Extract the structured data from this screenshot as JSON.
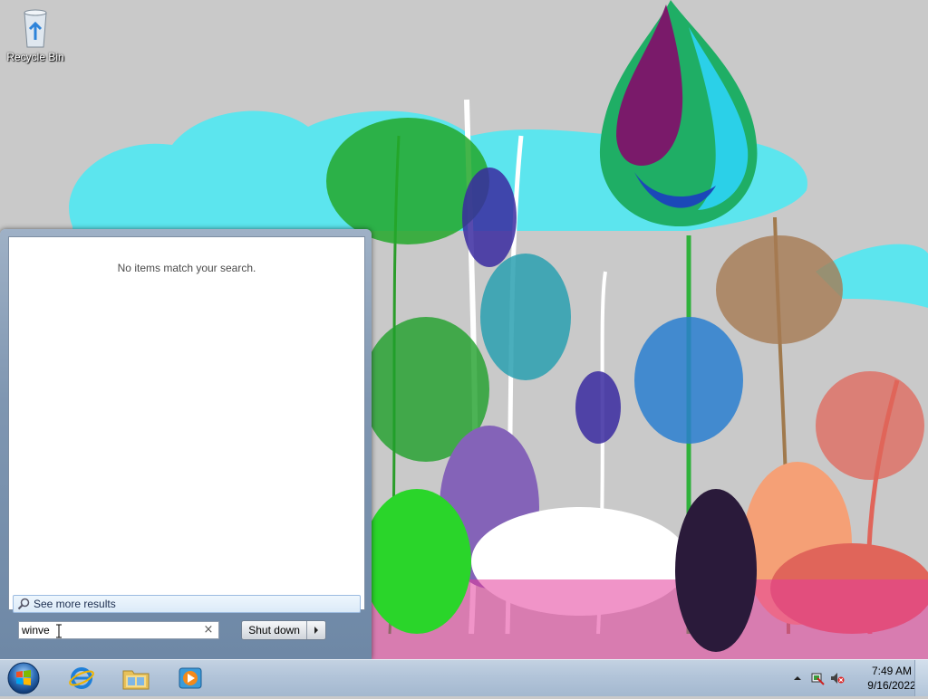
{
  "desktop": {
    "icons": [
      {
        "label": "Recycle Bin",
        "icon": "recycle-bin-icon"
      }
    ]
  },
  "start_menu": {
    "no_results_text": "No items match your search.",
    "see_more_label": "See more results",
    "search": {
      "value": "winve",
      "placeholder": ""
    },
    "clear_glyph": "×",
    "shutdown_label": "Shut down"
  },
  "taskbar": {
    "pinned": [
      {
        "name": "internet-explorer",
        "icon": "internet-explorer-icon"
      },
      {
        "name": "windows-explorer",
        "icon": "folder-icon"
      },
      {
        "name": "media-player",
        "icon": "media-player-icon"
      }
    ],
    "clock": {
      "time": "7:49 AM",
      "date": "9/16/2022"
    }
  },
  "colors": {
    "taskbar": "#b2c4d9",
    "start_menu_frame": "#7f96b1",
    "wallpaper_bg": "#c9c9c9",
    "wallpaper_cloud": "#5ce5ee"
  }
}
